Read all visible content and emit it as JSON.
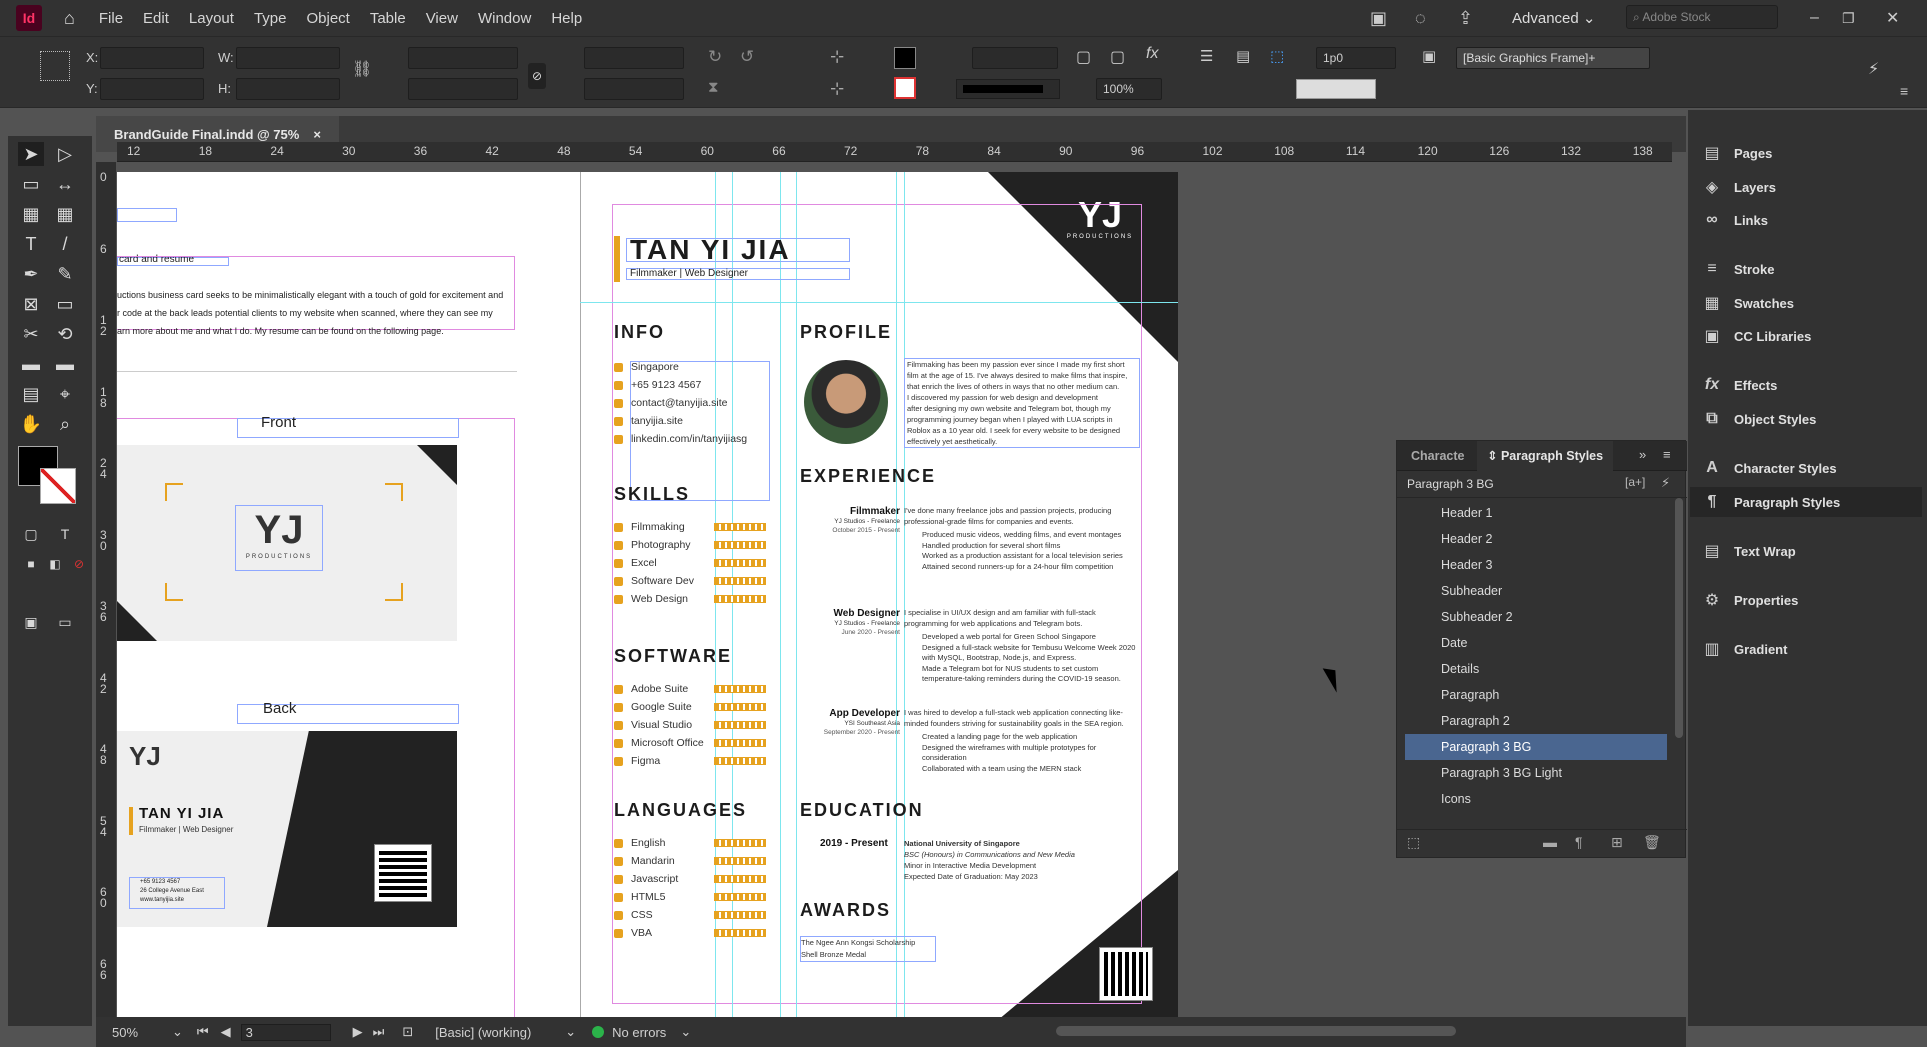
{
  "app": {
    "logo": "Id",
    "menus": [
      "File",
      "Edit",
      "Layout",
      "Type",
      "Object",
      "Table",
      "View",
      "Window",
      "Help"
    ],
    "workspace": "Advanced",
    "search_placeholder": "Adobe Stock"
  },
  "control": {
    "x_label": "X:",
    "y_label": "Y:",
    "w_label": "W:",
    "h_label": "H:",
    "stroke_weight": "1p0",
    "zoom": "100%",
    "frame_style": "[Basic Graphics Frame]+"
  },
  "tab": {
    "title": "BrandGuide Final.indd @ 75%",
    "close": "×"
  },
  "ruler": {
    "h": [
      "12",
      "18",
      "24",
      "30",
      "36",
      "42",
      "48",
      "54",
      "60",
      "66",
      "72",
      "78",
      "84",
      "90",
      "96",
      "102",
      "108",
      "114",
      "120",
      "126",
      "132",
      "138"
    ],
    "v": [
      "0",
      "6",
      "1 2",
      "1 8",
      "2 4",
      "3 0",
      "3 6",
      "4 2",
      "4 8",
      "5 4",
      "6 0",
      "6 6"
    ]
  },
  "page1": {
    "heading": "card and resume",
    "body": [
      "uctions business card seeks to be minimalistically elegant with a touch of gold for excitement and",
      "r code at the back leads potential clients to my website when scanned, where they can see my",
      "arn more about me and what I do. My resume can be found on the following page."
    ],
    "front_label": "Front",
    "back_label": "Back",
    "logo_text": "YJ",
    "logo_sub": "PRODUCTIONS",
    "name": "TAN YI JIA",
    "role": "Filmmaker | Web Designer",
    "contact": [
      "+65 9123 4567",
      "26 College Avenue East",
      "www.tanyijia.site"
    ]
  },
  "resume": {
    "name": "TAN YI JIA",
    "role": "Filmmaker | Web Designer",
    "logo_sub": "PRODUCTIONS",
    "info_title": "INFO",
    "info": [
      "Singapore",
      "+65 9123 4567",
      "contact@tanyijia.site",
      "tanyijia.site",
      "linkedin.com/in/tanyijiasg"
    ],
    "skills_title": "SKILLS",
    "skills": [
      "Filmmaking",
      "Photography",
      "Excel",
      "Software Dev",
      "Web Design"
    ],
    "software_title": "SOFTWARE",
    "software": [
      "Adobe Suite",
      "Google Suite",
      "Visual Studio",
      "Microsoft Office",
      "Figma"
    ],
    "languages_title": "LANGUAGES",
    "languages": [
      "English",
      "Mandarin",
      "Javascript",
      "HTML5",
      "CSS",
      "VBA"
    ],
    "profile_title": "PROFILE",
    "profile": [
      "Filmmaking has been my passion ever since I made my first short",
      "film at the age of 15. I've always desired to make films that inspire,",
      "that enrich the lives of others in ways that no other medium can.",
      "I discovered my passion for web design and development",
      "after designing my own website and Telegram bot, though my",
      "programming journey began when I played with LUA scripts in",
      "Roblox as a 10 year old. I seek for every website to be designed",
      "effectively yet aesthetically."
    ],
    "experience_title": "EXPERIENCE",
    "jobs": [
      {
        "role": "Filmmaker",
        "org": "YJ Studios - Freelance",
        "date": "October 2015 - Present",
        "desc": [
          "I've done many freelance jobs and passion projects, producing",
          "professional-grade films for companies and events."
        ],
        "bullets": [
          "Produced music videos, wedding films, and event montages",
          "Handled production for several short films",
          "Worked as a production assistant for a local television series",
          "Attained second runners-up for a 24-hour film competition"
        ]
      },
      {
        "role": "Web Designer",
        "org": "YJ Studios - Freelance",
        "date": "June 2020 - Present",
        "desc": [
          "I specialise in UI/UX design and am familiar with full-stack",
          "programming for web applications and Telegram bots."
        ],
        "bullets": [
          "Developed a web portal for Green School Singapore",
          "Designed a full-stack website for Tembusu Welcome Week 2020 with MySQL, Bootstrap, Node.js, and Express.",
          "Made a Telegram bot for NUS students to set custom temperature-taking reminders during the COVID-19 season."
        ]
      },
      {
        "role": "App Developer",
        "org": "YSI Southeast Asia",
        "date": "September 2020 - Present",
        "desc": [
          "I was hired to develop a full-stack web application connecting like-",
          "minded founders striving for sustainability goals in the SEA region."
        ],
        "bullets": [
          "Created a landing page for the web application",
          "Designed the wireframes with multiple prototypes for consideration",
          "Collaborated with a team using the MERN stack"
        ]
      }
    ],
    "education_title": "EDUCATION",
    "edu_date": "2019 - Present",
    "edu": [
      "National University of Singapore",
      "BSC (Honours) in Communications and New Media",
      "Minor in Interactive Media Development",
      "Expected Date of Graduation: May 2023"
    ],
    "awards_title": "AWARDS",
    "awards": [
      "The Ngee Ann Kongsi Scholarship",
      "Shell Bronze Medal"
    ]
  },
  "panels": [
    {
      "label": "Pages",
      "icon": "pages-icon"
    },
    {
      "label": "Layers",
      "icon": "layers-icon"
    },
    {
      "label": "Links",
      "icon": "links-icon"
    },
    {
      "label": "Stroke",
      "icon": "stroke-icon"
    },
    {
      "label": "Swatches",
      "icon": "swatches-icon"
    },
    {
      "label": "CC Libraries",
      "icon": "cc-libraries-icon"
    },
    {
      "label": "Effects",
      "icon": "effects-icon"
    },
    {
      "label": "Object Styles",
      "icon": "object-styles-icon"
    },
    {
      "label": "Character Styles",
      "icon": "character-styles-icon"
    },
    {
      "label": "Paragraph Styles",
      "icon": "paragraph-styles-icon"
    },
    {
      "label": "Text Wrap",
      "icon": "text-wrap-icon"
    },
    {
      "label": "Properties",
      "icon": "properties-icon"
    },
    {
      "label": "Gradient",
      "icon": "gradient-icon"
    }
  ],
  "pstyles": {
    "tab_char": "Characte",
    "tab_para": "Paragraph Styles",
    "current": "Paragraph 3 BG",
    "items": [
      "Header 1",
      "Header 2",
      "Header 3",
      "Subheader",
      "Subheader 2",
      "Date",
      "Details",
      "Paragraph",
      "Paragraph 2",
      "Paragraph 3 BG",
      "Paragraph 3 BG Light",
      "Icons"
    ],
    "selected": "Paragraph 3 BG"
  },
  "status": {
    "zoom": "50%",
    "page": "3",
    "master": "[Basic] (working)",
    "errors": "No errors"
  },
  "colors": {
    "accent": "#e6a21f",
    "dark": "#222222",
    "selection": "#4a6690"
  }
}
